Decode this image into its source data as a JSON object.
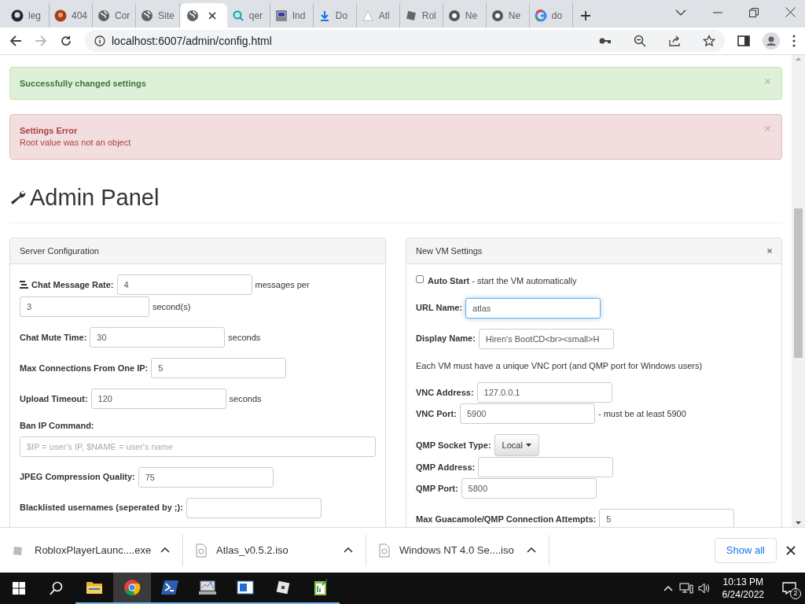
{
  "browser": {
    "tabs": [
      {
        "title": "leg",
        "kind": "github",
        "selected": false
      },
      {
        "title": "404",
        "kind": "avatar",
        "selected": false
      },
      {
        "title": "Cor",
        "kind": "globe",
        "selected": false
      },
      {
        "title": "Site",
        "kind": "globe",
        "selected": false
      },
      {
        "kind": "globe",
        "selected": true
      },
      {
        "title": "qer",
        "kind": "search",
        "selected": false
      },
      {
        "title": "Ind",
        "kind": "pc",
        "selected": false
      },
      {
        "title": "Do",
        "kind": "download",
        "selected": false
      },
      {
        "title": "Atl",
        "kind": "triangle",
        "selected": false
      },
      {
        "title": "Rol",
        "kind": "square",
        "selected": false
      },
      {
        "title": "Ne",
        "kind": "chrome",
        "selected": false
      },
      {
        "title": "Ne",
        "kind": "chrome",
        "selected": false
      },
      {
        "title": "do",
        "kind": "google",
        "selected": false
      }
    ],
    "url": "localhost:6007/admin/config.html"
  },
  "alerts": [
    {
      "kind": "success",
      "title": "Successfully changed settings"
    },
    {
      "kind": "error",
      "title": "Settings Error",
      "message": "Root value was not an object"
    }
  ],
  "heading": "Admin Panel",
  "panels": [
    {
      "title": "Server Configuration",
      "closable": false,
      "groups": [
        [
          {
            "kind": "rate",
            "label": "Chat Message Rate:",
            "value": "4",
            "suffix": "messages per",
            "value2": "3",
            "suffix2": "second(s)"
          }
        ],
        [
          {
            "kind": "input",
            "label": "Chat Mute Time:",
            "value": "30",
            "suffix": "seconds"
          }
        ],
        [
          {
            "kind": "input",
            "label": "Max Connections From One IP:",
            "value": "5"
          }
        ],
        [
          {
            "kind": "input",
            "label": "Upload Timeout:",
            "value": "120",
            "suffix": "seconds"
          }
        ],
        [
          {
            "kind": "block",
            "label": "Ban IP Command:",
            "placeholder": "$IP = user's IP, $NAME = user's name"
          }
        ],
        [
          {
            "kind": "input",
            "label": "JPEG Compression Quality:",
            "value": "75"
          }
        ],
        [
          {
            "kind": "input",
            "label": "Blacklisted usernames (seperated by ;):"
          }
        ]
      ]
    },
    {
      "title": "New VM Settings",
      "closable": true,
      "groups": [
        [
          {
            "kind": "checkbox",
            "label": "Auto Start",
            "note": " - start the VM automatically",
            "checked": false
          }
        ],
        [
          {
            "kind": "input",
            "label": "URL Name:",
            "value": "atlas",
            "focused": true
          }
        ],
        [
          {
            "kind": "input",
            "label": "Display Name:",
            "value": "Hiren's BootCD<br><small>H",
            "focused": false
          }
        ],
        [
          {
            "kind": "note",
            "text": "Each VM must have a unique VNC port (and QMP port for Windows users)"
          }
        ],
        [
          {
            "kind": "input",
            "label": "VNC Address:",
            "value": "127.0.0.1"
          },
          {
            "kind": "input",
            "label": "VNC Port:",
            "value": "5900",
            "suffix": "- must be at least 5900"
          }
        ],
        [
          {
            "kind": "dropdown",
            "label": "QMP Socket Type:",
            "value": "Local"
          },
          {
            "kind": "input",
            "label": "QMP Address:"
          },
          {
            "kind": "input",
            "label": "QMP Port:",
            "value": "5800"
          }
        ],
        [
          {
            "kind": "input",
            "label": "Max Guacamole/QMP Connection Attempts:",
            "value": "5"
          }
        ]
      ]
    }
  ],
  "downloads": [
    {
      "name": "RobloxPlayerLaunc....exe",
      "kind": "app"
    },
    {
      "name": "Atlas_v0.5.2.iso",
      "kind": "disc"
    },
    {
      "name": "Windows NT 4.0 Se....iso",
      "kind": "disc"
    }
  ],
  "show_all": "Show all",
  "taskbar": {
    "apps": [
      {
        "kind": "folder",
        "selected": false
      },
      {
        "kind": "chrome",
        "selected": true
      },
      {
        "kind": "terminal",
        "selected": false
      },
      {
        "kind": "monitor",
        "selected": false
      },
      {
        "kind": "window",
        "selected": false
      },
      {
        "kind": "square",
        "selected": false
      },
      {
        "kind": "notepad",
        "selected": false
      }
    ],
    "time": "10:13 PM",
    "date": "6/24/2022",
    "notifications": "2"
  }
}
